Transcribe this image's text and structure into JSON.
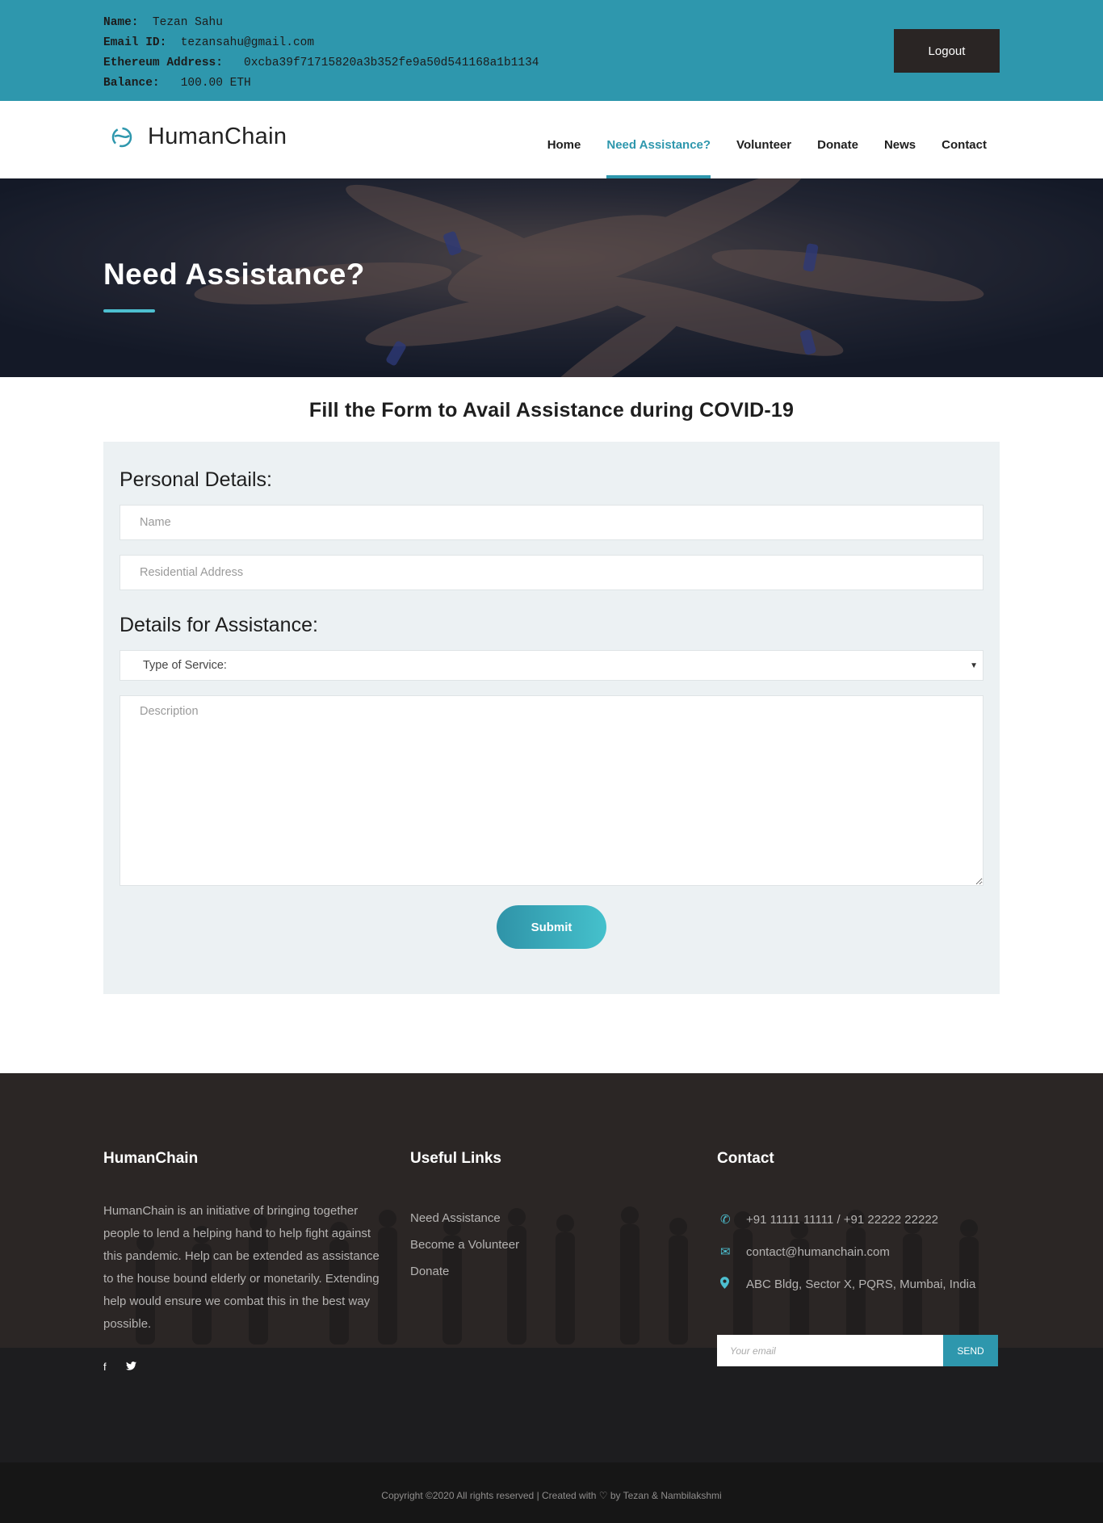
{
  "account": {
    "name_label": "Name:",
    "name_value": "Tezan Sahu",
    "email_label": "Email ID:",
    "email_value": "tezansahu@gmail.com",
    "eth_label": "Ethereum Address:",
    "eth_value": "0xcba39f71715820a3b352fe9a50d541168a1b1134",
    "balance_label": "Balance:",
    "balance_value": "100.00 ETH",
    "logout_label": "Logout"
  },
  "brand": {
    "name": "HumanChain",
    "logo_icon": "globe-icon"
  },
  "nav": {
    "home": "Home",
    "need_assistance": "Need Assistance?",
    "volunteer": "Volunteer",
    "donate": "Donate",
    "news": "News",
    "contact": "Contact",
    "active": "need_assistance"
  },
  "hero": {
    "title": "Need Assistance?"
  },
  "form": {
    "heading": "Fill the Form to Avail Assistance during COVID-19",
    "personal_title": "Personal Details:",
    "name_placeholder": "Name",
    "address_placeholder": "Residential Address",
    "assistance_title": "Details for Assistance:",
    "service_selected": "Type of Service:",
    "description_placeholder": "Description",
    "submit_label": "Submit"
  },
  "footer": {
    "about_title": "HumanChain",
    "about_text": "HumanChain is an initiative of bringing together people to lend a helping hand to help fight against this pandemic. Help can be extended as assistance to the house bound elderly or monetarily. Extending help would ensure we combat this in the best way possible.",
    "social": [
      "facebook-icon",
      "twitter-icon"
    ],
    "links_title": "Useful Links",
    "links": [
      "Need Assistance",
      "Become a Volunteer",
      "Donate"
    ],
    "contact_title": "Contact",
    "phone": "+91 11111 11111 / +91 22222 22222",
    "email": "contact@humanchain.com",
    "address": "ABC Bldg, Sector X, PQRS, Mumbai, India",
    "subscribe_placeholder": "Your email",
    "subscribe_button": "SEND",
    "copyright_pre": "Copyright ©2020 All rights reserved | Created with",
    "copyright_post": "by Tezan & Nambilakshmi"
  },
  "colors": {
    "accent": "#2e97ad",
    "dark": "#2b2625",
    "form_bg": "#ecf1f3"
  }
}
